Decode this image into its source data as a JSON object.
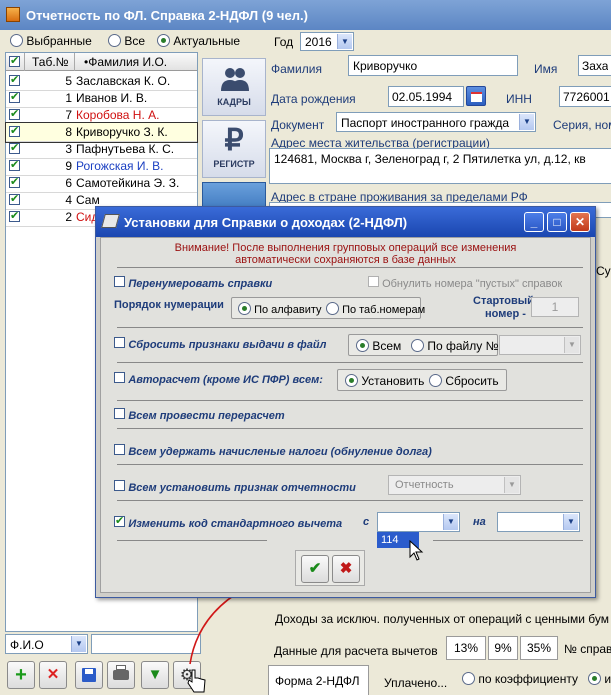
{
  "window": {
    "title": "Отчетность по ФЛ. Справка 2-НДФЛ (9 чел.)"
  },
  "filter": {
    "options": [
      "Выбранные",
      "Все",
      "Актуальные"
    ],
    "selected": 2,
    "year_label": "Год",
    "year_value": "2016"
  },
  "grid": {
    "col_tab": "Таб.№",
    "col_name": "•Фамилия И.О.",
    "rows": [
      {
        "num": "5",
        "name": "Заславская К. О.",
        "color": "#000000"
      },
      {
        "num": "1",
        "name": "Иванов И. В.",
        "color": "#000000"
      },
      {
        "num": "7",
        "name": "Коробова Н. А.",
        "color": "#d01010"
      },
      {
        "num": "8",
        "name": "Криворучко З. К.",
        "color": "#000000"
      },
      {
        "num": "3",
        "name": "Пафнутьева К. С.",
        "color": "#000000"
      },
      {
        "num": "9",
        "name": "Рогожская И. В.",
        "color": "#1a3fc2"
      },
      {
        "num": "6",
        "name": "Самотейкина Э. З.",
        "color": "#000000"
      },
      {
        "num": "4",
        "name": "Сам",
        "color": "#000000"
      },
      {
        "num": "2",
        "name": "Сид",
        "color": "#d01010"
      }
    ],
    "selected_row": 3
  },
  "nav": {
    "kadry": "КАДРЫ",
    "registr": "РЕГИСТР"
  },
  "form": {
    "surname_label": "Фамилия",
    "surname_value": "Криворучко",
    "name_label": "Имя",
    "name_value": "Заха",
    "birth_label": "Дата рождения",
    "birth_value": "02.05.1994",
    "inn_label": "ИНН",
    "inn_value": "7726001",
    "doc_label": "Документ",
    "doc_value": "Паспорт иностранного гражда",
    "series_label": "Серия, ном",
    "address_label": "Адрес места жительства (регистрации)",
    "address_value": "124681, Москва г, Зеленоград г, 2 Пятилетка ул, д.12, кв",
    "foreign_label": "Адрес в стране проживания за пределами РФ",
    "su_label": "Су"
  },
  "dialog": {
    "title": "Установки для Справки о доходах (2-НДФЛ)",
    "warning1": "Внимание! После выполнения групповых операций все изменения",
    "warning2": "автоматически сохраняются в базе данных",
    "renumber": "Перенумеровать справки",
    "zero_empty": "Обнулить номера \"пустых\" справок",
    "order_label": "Порядок нумерации",
    "order_alpha": "По алфавиту",
    "order_tab": "По таб.номерам",
    "start_label": "Стартовый",
    "start_label2": "номер -",
    "start_value": "1",
    "reset_issue": "Сбросить признаки выдачи в файл",
    "all_label": "Всем",
    "by_file_label": "По файлу №:",
    "autocalc": "Авторасчет (кроме ИС ПФР) всем:",
    "set_label": "Установить",
    "reset_label": "Сбросить",
    "recalc": "Всем провести перерасчет",
    "withhold": "Всем удержать начисленые налоги (обнуление долга)",
    "report_sign": "Всем установить признак отчетности",
    "report_value": "Отчетность",
    "change_code": "Изменить код стандартного вычета",
    "from_label": "с",
    "to_label": "на",
    "dropdown_item": "114",
    "ok_icon": "✔",
    "cancel_icon": "✖"
  },
  "search": {
    "field_value": "Ф.И.О"
  },
  "bottom": {
    "income_label": "Доходы за исключ. полученных от операций с ценными бум",
    "deductions_label": "Данные для расчета вычетов",
    "pct13": "13%",
    "pct9": "9%",
    "pct35": "35%",
    "nr_label": "№ справ",
    "tab_form": "Форма 2-НДФЛ",
    "paid_label": "Уплачено...",
    "by_coef": "по коэффициенту",
    "last_item": "и"
  },
  "colors": {
    "accent": "#1a46b0",
    "warning": "#9a1010",
    "check": "#1a8a1a"
  }
}
